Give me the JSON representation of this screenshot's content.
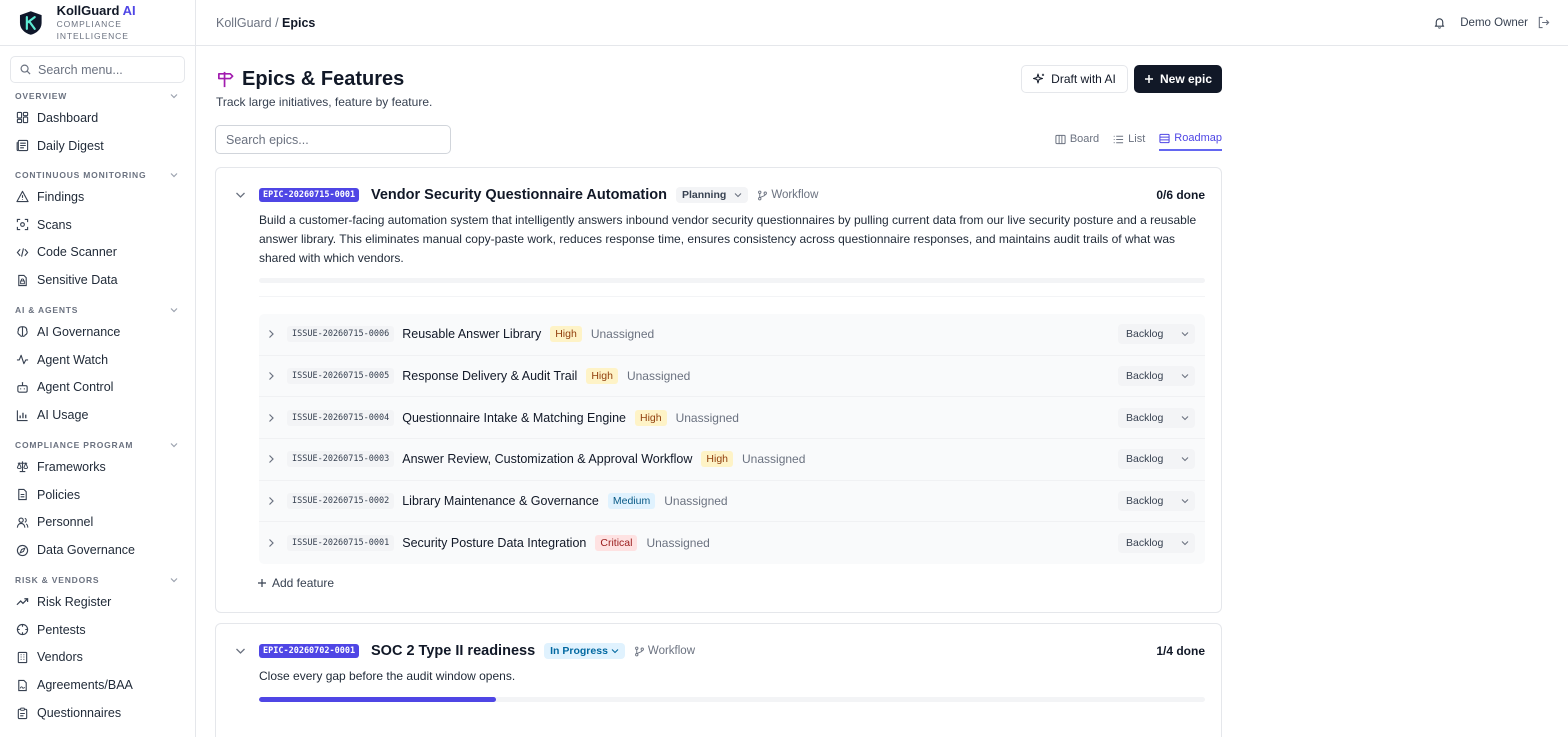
{
  "brand": {
    "name": "KollGuard",
    "name_ai": "AI",
    "tagline": "COMPLIANCE INTELLIGENCE"
  },
  "sidebar": {
    "search_placeholder": "Search menu...",
    "sections": [
      {
        "title": "OVERVIEW",
        "items": [
          {
            "label": "Dashboard",
            "icon": "dashboard-icon"
          },
          {
            "label": "Daily Digest",
            "icon": "newspaper-icon"
          }
        ]
      },
      {
        "title": "CONTINUOUS MONITORING",
        "items": [
          {
            "label": "Findings",
            "icon": "alert-triangle-icon"
          },
          {
            "label": "Scans",
            "icon": "scan-icon"
          },
          {
            "label": "Code Scanner",
            "icon": "code-icon"
          },
          {
            "label": "Sensitive Data",
            "icon": "file-lock-icon"
          }
        ]
      },
      {
        "title": "AI & AGENTS",
        "items": [
          {
            "label": "AI Governance",
            "icon": "brain-icon"
          },
          {
            "label": "Agent Watch",
            "icon": "activity-icon"
          },
          {
            "label": "Agent Control",
            "icon": "bot-icon"
          },
          {
            "label": "AI Usage",
            "icon": "bar-chart-icon"
          }
        ]
      },
      {
        "title": "COMPLIANCE PROGRAM",
        "items": [
          {
            "label": "Frameworks",
            "icon": "scale-icon"
          },
          {
            "label": "Policies",
            "icon": "document-icon"
          },
          {
            "label": "Personnel",
            "icon": "users-icon"
          },
          {
            "label": "Data Governance",
            "icon": "compass-icon"
          }
        ]
      },
      {
        "title": "RISK & VENDORS",
        "items": [
          {
            "label": "Risk Register",
            "icon": "trending-up-icon"
          },
          {
            "label": "Pentests",
            "icon": "target-icon"
          },
          {
            "label": "Vendors",
            "icon": "building-icon"
          },
          {
            "label": "Agreements/BAA",
            "icon": "file-signature-icon"
          },
          {
            "label": "Questionnaires",
            "icon": "clipboard-icon"
          }
        ]
      }
    ]
  },
  "topbar": {
    "crumb_root": "KollGuard",
    "crumb_sep": " / ",
    "crumb_current": "Epics",
    "user": "Demo Owner"
  },
  "page": {
    "title": "Epics & Features",
    "subtitle": "Track large initiatives, feature by feature.",
    "draft_label": "Draft with AI",
    "new_label": "New epic",
    "search_placeholder": "Search epics...",
    "views": [
      "Board",
      "List",
      "Roadmap"
    ],
    "active_view": "Roadmap"
  },
  "epics": [
    {
      "id": "EPIC-20260715-0001",
      "title": "Vendor Security Questionnaire Automation",
      "status": "Planning",
      "workflow": "Workflow",
      "done": "0/6 done",
      "progress": 0,
      "description": "Build a customer-facing automation system that intelligently answers inbound vendor security questionnaires by pulling current data from our live security posture and a reusable answer library. This eliminates manual copy-paste work, reduces response time, ensures consistency across questionnaire responses, and maintains audit trails of what was shared with which vendors.",
      "features": [
        {
          "id": "ISSUE-20260715-0006",
          "title": "Reusable Answer Library",
          "priority": "High",
          "assignee": "Unassigned",
          "status": "Backlog"
        },
        {
          "id": "ISSUE-20260715-0005",
          "title": "Response Delivery & Audit Trail",
          "priority": "High",
          "assignee": "Unassigned",
          "status": "Backlog"
        },
        {
          "id": "ISSUE-20260715-0004",
          "title": "Questionnaire Intake & Matching Engine",
          "priority": "High",
          "assignee": "Unassigned",
          "status": "Backlog"
        },
        {
          "id": "ISSUE-20260715-0003",
          "title": "Answer Review, Customization & Approval Workflow",
          "priority": "High",
          "assignee": "Unassigned",
          "status": "Backlog"
        },
        {
          "id": "ISSUE-20260715-0002",
          "title": "Library Maintenance & Governance",
          "priority": "Medium",
          "assignee": "Unassigned",
          "status": "Backlog"
        },
        {
          "id": "ISSUE-20260715-0001",
          "title": "Security Posture Data Integration",
          "priority": "Critical",
          "assignee": "Unassigned",
          "status": "Backlog"
        }
      ],
      "add_feature": "Add feature"
    },
    {
      "id": "EPIC-20260702-0001",
      "title": "SOC 2 Type II readiness",
      "status": "In Progress",
      "workflow": "Workflow",
      "done": "1/4 done",
      "progress": 0.25,
      "description": "Close every gap before the audit window opens."
    }
  ],
  "colors": {
    "accent": "#4f46e5",
    "primary_button": "#111827"
  }
}
